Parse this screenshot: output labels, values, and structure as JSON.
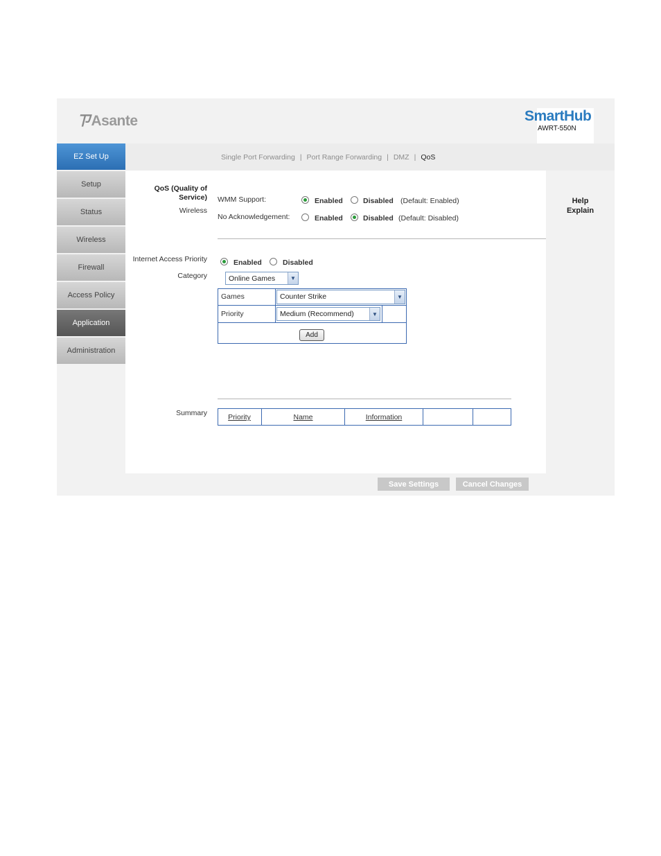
{
  "header": {
    "brand": "Asante",
    "brand_mark": "ㄗ",
    "product_name": "SmartHub",
    "product_model": "AWRT-550N"
  },
  "sidebar": {
    "items": [
      {
        "label": "EZ Set Up",
        "state": "active"
      },
      {
        "label": "Setup"
      },
      {
        "label": "Status"
      },
      {
        "label": "Wireless"
      },
      {
        "label": "Firewall"
      },
      {
        "label": "Access Policy"
      },
      {
        "label": "Application",
        "state": "selected"
      },
      {
        "label": "Administration"
      }
    ]
  },
  "tabs": {
    "items": [
      "Single Port Forwarding",
      "Port Range Forwarding",
      "DMZ",
      "QoS"
    ],
    "separator": "|",
    "current": "QoS"
  },
  "help": {
    "line1": "Help",
    "line2": "Explain"
  },
  "qos": {
    "section_label_line1": "QoS (Quality of",
    "section_label_line2": "Service)",
    "wireless_label": "Wireless",
    "wmm_label": "WMM Support:",
    "wmm_enabled_label": "Enabled",
    "wmm_disabled_label": "Disabled",
    "wmm_default": "(Default: Enabled)",
    "wmm_value": "Enabled",
    "noack_label": "No Acknowledgement:",
    "noack_enabled_label": "Enabled",
    "noack_disabled_label": "Disabled",
    "noack_default": "(Default: Disabled)",
    "noack_value": "Disabled"
  },
  "internet_priority": {
    "label": "Internet Access Priority",
    "enabled_label": "Enabled",
    "disabled_label": "Disabled",
    "value": "Enabled",
    "category_label": "Category",
    "category_value": "Online Games",
    "games_label": "Games",
    "games_value": "Counter Strike",
    "priority_label": "Priority",
    "priority_value": "Medium (Recommend)",
    "add_label": "Add"
  },
  "summary": {
    "label": "Summary",
    "columns": [
      "Priority",
      "Name",
      "Information",
      "",
      ""
    ]
  },
  "footer": {
    "save_label": "Save Settings",
    "cancel_label": "Cancel Changes"
  },
  "colors": {
    "accent": "#2c6fb3",
    "brand_blue": "#2a7bbf",
    "radio_on": "#2a9a3a",
    "table_border": "#3b69b0"
  }
}
